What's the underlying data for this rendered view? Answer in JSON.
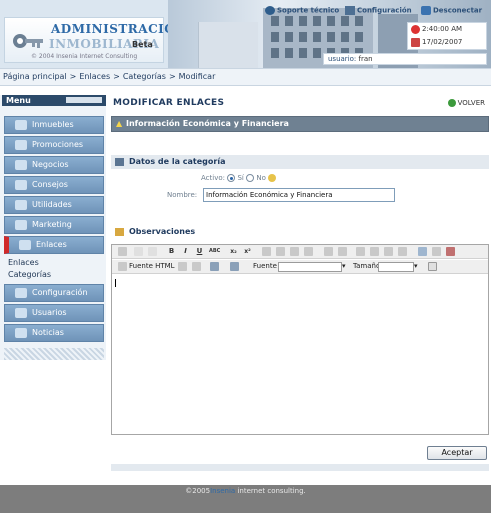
{
  "header": {
    "logo_line1": "ADMINISTRACIÓN",
    "logo_line2": "INMOBILIARIA",
    "logo_beta": "Beta",
    "logo_copyright": "© 2004 Insenia Internet Consulting",
    "nav": [
      {
        "label": "Soporte técnico",
        "icon": "support-icon"
      },
      {
        "label": "Configuración",
        "icon": "config-icon"
      },
      {
        "label": "Desconectar",
        "icon": "logout-icon"
      }
    ],
    "time": "2:40:00 AM",
    "date": "17/02/2007",
    "user_label": "usuario:",
    "user_name": "fran"
  },
  "breadcrumb": [
    "Página principal",
    ">",
    "Enlaces",
    ">",
    "Categorías",
    ">",
    "Modificar"
  ],
  "sidebar": {
    "title": "Menu",
    "items": [
      {
        "label": "Inmuebles",
        "icon": "building-icon"
      },
      {
        "label": "Promociones",
        "icon": "megaphone-icon"
      },
      {
        "label": "Negocios",
        "icon": "briefcase-icon"
      },
      {
        "label": "Consejos",
        "icon": "lightbulb-icon"
      },
      {
        "label": "Utilidades",
        "icon": "tools-icon"
      },
      {
        "label": "Marketing",
        "icon": "chart-icon"
      },
      {
        "label": "Enlaces",
        "icon": "link-icon",
        "active": true
      },
      {
        "label": "Configuración",
        "icon": "gear-icon"
      },
      {
        "label": "Usuarios",
        "icon": "users-icon"
      },
      {
        "label": "Noticias",
        "icon": "news-icon"
      }
    ],
    "subitems": [
      "Enlaces",
      "Categorías"
    ]
  },
  "main": {
    "title": "MODIFICAR ENLACES",
    "back_label": "VOLVER",
    "bar_title": "Información Económica y Financiera",
    "section_category": "Datos de la categoría",
    "activo_label": "Activo:",
    "activo_si": "Sí",
    "activo_no": "No",
    "activo_value": "Sí",
    "nombre_label": "Nombre:",
    "nombre_value": "Información Económica y Financiera",
    "section_obs": "Observaciones",
    "editor": {
      "source_label": "Fuente HTML",
      "font_label": "Fuente",
      "size_label": "Tamaño",
      "content": ""
    },
    "accept_label": "Aceptar"
  },
  "footer": {
    "prefix": "©2005",
    "brand": "Insenia",
    "suffix": "internet consulting."
  },
  "colors": {
    "accent": "#2e6aa7",
    "sidebar_item": "#7c9fc4",
    "active_marker": "#d02a2a",
    "title_bar": "#6f8192",
    "footer_bg": "#7d7d7d"
  }
}
